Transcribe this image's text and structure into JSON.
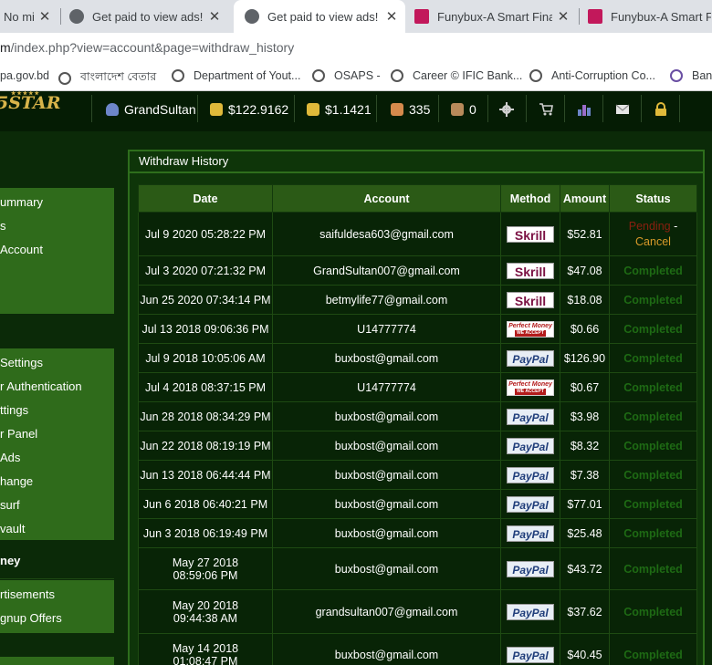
{
  "browser": {
    "tabs": [
      {
        "label": "No mi"
      },
      {
        "label": "Get paid to view ads!"
      },
      {
        "label": "Get paid to view ads!"
      },
      {
        "label": "Funybux-A Smart Finan"
      },
      {
        "label": "Funybux-A Smart Finan"
      }
    ],
    "close_glyph": "✕",
    "url_host": "m",
    "url_path": "/index.php?view=account&page=withdraw_history",
    "bookmarks": [
      {
        "label": "pa.gov.bd"
      },
      {
        "label": "বাংলাদেশ বেতার"
      },
      {
        "label": "Department of Yout..."
      },
      {
        "label": "OSAPS -"
      },
      {
        "label": "Career © IFIC Bank..."
      },
      {
        "label": "Anti-Corruption Co..."
      },
      {
        "label": "Ban"
      }
    ]
  },
  "header": {
    "logo": "5STAR",
    "logo_stars": "★★★★★",
    "username": "GrandSultan",
    "balance_1": "$122.9162",
    "balance_2": "$1.1421",
    "referrals": "335",
    "count": "0",
    "icons": [
      "gear-icon",
      "cart-icon",
      "chart-icon",
      "mail-icon",
      "lock-icon"
    ]
  },
  "sidebar": {
    "block1": [
      "ummary",
      "s",
      "Account"
    ],
    "block2": [
      "Settings",
      "r Authentication",
      "ttings",
      "r Panel",
      " Ads",
      "hange",
      "surf",
      "vault"
    ],
    "section_head": "ney",
    "block3": [
      "rtisements",
      "gnup Offers"
    ]
  },
  "main": {
    "title": "Withdraw History",
    "columns": [
      "Date",
      "Account",
      "Method",
      "Amount",
      "Status"
    ],
    "separator": " - ",
    "rows": [
      {
        "date": "Jul 9 2020 05:28:22 PM",
        "account": "saifuldesa603@gmail.com",
        "method": "Skrill",
        "amount": "$52.81",
        "status": "Pending",
        "action": "Cancel"
      },
      {
        "date": "Jul 3 2020 07:21:32 PM",
        "account": "GrandSultan007@gmail.com",
        "method": "Skrill",
        "amount": "$47.08",
        "status": "Completed"
      },
      {
        "date": "Jun 25 2020 07:34:14 PM",
        "account": "betmylife77@gmail.com",
        "method": "Skrill",
        "amount": "$18.08",
        "status": "Completed"
      },
      {
        "date": "Jul 13 2018 09:06:36 PM",
        "account": "U14777774",
        "method": "Perfect Money",
        "amount": "$0.66",
        "status": "Completed"
      },
      {
        "date": "Jul 9 2018 10:05:06 AM",
        "account": "buxbost@gmail.com",
        "method": "PayPal",
        "amount": "$126.90",
        "status": "Completed"
      },
      {
        "date": "Jul 4 2018 08:37:15 PM",
        "account": "U14777774",
        "method": "Perfect Money",
        "amount": "$0.67",
        "status": "Completed"
      },
      {
        "date": "Jun 28 2018 08:34:29 PM",
        "account": "buxbost@gmail.com",
        "method": "PayPal",
        "amount": "$3.98",
        "status": "Completed"
      },
      {
        "date": "Jun 22 2018 08:19:19 PM",
        "account": "buxbost@gmail.com",
        "method": "PayPal",
        "amount": "$8.32",
        "status": "Completed"
      },
      {
        "date": "Jun 13 2018 06:44:44 PM",
        "account": "buxbost@gmail.com",
        "method": "PayPal",
        "amount": "$7.38",
        "status": "Completed"
      },
      {
        "date": "Jun 6 2018 06:40:21 PM",
        "account": "buxbost@gmail.com",
        "method": "PayPal",
        "amount": "$77.01",
        "status": "Completed"
      },
      {
        "date": "Jun 3 2018 06:19:49 PM",
        "account": "buxbost@gmail.com",
        "method": "PayPal",
        "amount": "$25.48",
        "status": "Completed"
      },
      {
        "date": "May 27 2018 08:59:06 PM",
        "account": "buxbost@gmail.com",
        "method": "PayPal",
        "amount": "$43.72",
        "status": "Completed"
      },
      {
        "date": "May 20 2018 09:44:38 AM",
        "account": "grandsultan007@gmail.com",
        "method": "PayPal",
        "amount": "$37.62",
        "status": "Completed"
      },
      {
        "date": "May 14 2018 01:08:47 PM",
        "account": "buxbost@gmail.com",
        "method": "PayPal",
        "amount": "$40.45",
        "status": "Completed"
      }
    ],
    "badge_text": {
      "skrill": "Skrill",
      "paypal": "PayPal",
      "pm": "Perfect Money",
      "pm_sub": "WE ACCEPT"
    }
  },
  "colors": {
    "pending": "#8b1f10",
    "cancel": "#d89a2a",
    "completed": "#1e6a14",
    "header_bg": "#2b5a16",
    "sidebar_active": "#2f6b1b"
  }
}
